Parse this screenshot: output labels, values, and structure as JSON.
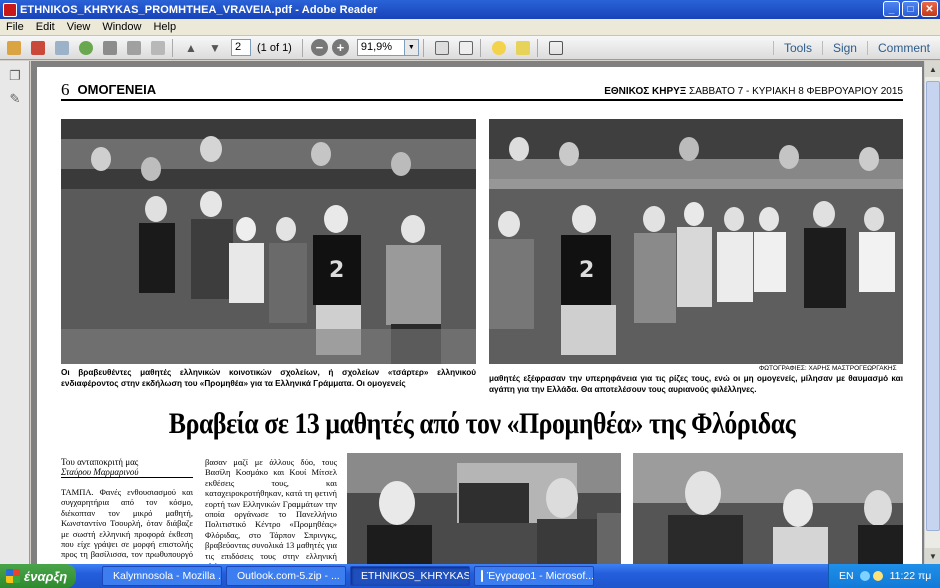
{
  "window": {
    "title": "ETHNIKOS_KHRYKAS_PROMHTHEA_VRAVEIA.pdf - Adobe Reader"
  },
  "menu": [
    "File",
    "Edit",
    "View",
    "Window",
    "Help"
  ],
  "toolbar": {
    "page_value": "2",
    "page_count": "(1 of 1)",
    "zoom_value": "91,9%",
    "right_links": [
      "Tools",
      "Sign",
      "Comment"
    ]
  },
  "newspaper": {
    "page_number": "6",
    "section": "ΟΜΟΓΕΝΕΙΑ",
    "paper_name": "ΕΘΝΙΚΟΣ ΚΗΡΥΞ",
    "paper_date": "ΣΑΒΒΑΤΟ 7 - ΚΥΡΙΑΚΗ 8 ΦΕΒΡΟΥΑΡΙΟΥ 2015",
    "caption_left": "Οι βραβευθέντες μαθητές ελληνικών κοινοτικών σχολείων, ή σχολείων «τσάρτερ» ελληνικού ενδιαφέροντος στην εκδήλωση του «Προμηθέα» για τα Ελληνικά Γράμματα. Οι ομογενείς",
    "caption_right": "μαθητές εξέφρασαν την υπερηφάνεια για τις ρίζες τους, ενώ οι μη ομογενείς, μίλησαν με θαυμασμό και αγάπη για την Ελλάδα. Θα αποτελέσουν τους αυριανούς φιλέλληνες.",
    "photo_credit": "ΦΩΤΟΓΡΑΦΙΕΣ: ΧΑΡΗΣ ΜΑΣΤΡΟΓΕΩΡΓΑΚΗΣ",
    "headline": "Βραβεία σε 13 μαθητές από τον «Προμηθέα» της Φλόριδας",
    "byline_prefix": "Του ανταποκριτή μας",
    "byline_name": "Σταύρου Μαρμαρινού",
    "col1_text": "ΤΑΜΠΑ. Φανές ενθουσιασμού και συγχαρητήρια από τον κόσμο, διέκοπταν τον μικρό μαθητή, Κωνσταντίνο Τσουρλή, όταν διάβαζε με σωστή ελληνική προφορά έκθεση που είχε γράψει σε μορφή επιστολής προς τη βασίλισσα, τον πρωθυπουργό και τους",
    "col2_text": "βασαν μαζί με άλλους δύο, τους Βασίλη Κοσμάκο και Κουί Μίτσελ εκθέσεις τους, και καταχειροκροτήθηκαν, κατά τη φετινή εορτή των Ελληνικών Γραμμάτων την οποία οργάνωσε το Πανελλήνιο Πολιτιστικό Κέντρο «Προμηθέας» Φλόριδας, στο Τάρπον Σπρινγκς, βραβεύοντας συνολικά 13 μαθητές για τις επιδόσεις τους στην ελληνική γλώσσα."
  },
  "taskbar": {
    "start_label": "έναρξη",
    "tasks": [
      "Kalymnosola - Mozilla ...",
      "Outlook.com-5.zip - ...",
      "ETHNIKOS_KHRYKAS...",
      "Έγγραφο1 - Microsof..."
    ],
    "lang": "EN",
    "time": "11:22 πμ"
  }
}
